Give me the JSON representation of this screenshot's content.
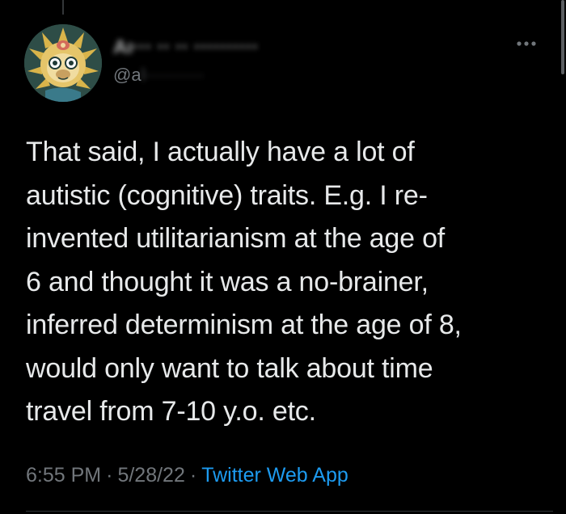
{
  "tweet": {
    "author": {
      "display_name": "Aı··· ·· ·· ··········",
      "handle_prefix": "@a",
      "handle_rest": "l··········"
    },
    "text_lines": [
      "That said, I actually have a lot of",
      "autistic (cognitive) traits. E.g. I re-",
      "invented utilitarianism at the age of",
      "6 and thought it was a no-brainer,",
      "inferred determinism at the age of 8,",
      "would only want to talk about time",
      "travel from 7-10 y.o. etc."
    ],
    "time": "6:55 PM",
    "date": "5/28/22",
    "separator": "·",
    "source": "Twitter Web App"
  },
  "icons": {
    "more": "more-horizontal-icon",
    "avatar": "monkey-avatar"
  },
  "colors": {
    "background": "#000000",
    "text": "#e7e9ea",
    "secondary": "#71767b",
    "link": "#1d9bf0",
    "divider": "#2f3336"
  }
}
